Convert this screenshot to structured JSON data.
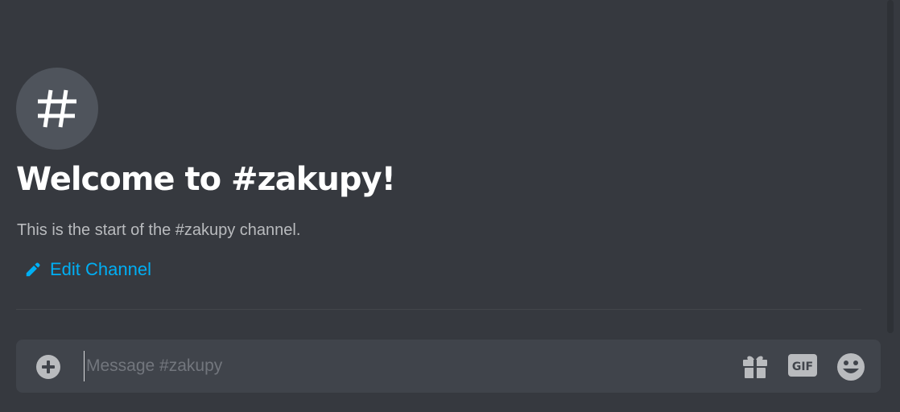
{
  "channel": {
    "icon": "hashtag-icon",
    "welcome_title": "Welcome to #zakupy!",
    "welcome_subtitle": "This is the start of the #zakupy channel.",
    "edit_label": "Edit Channel"
  },
  "composer": {
    "placeholder": "Message #zakupy",
    "attach_icon": "plus-circle-icon",
    "gift_icon": "gift-icon",
    "gif_label": "GIF",
    "emoji_icon": "smiley-emoji-icon"
  },
  "colors": {
    "background": "#36393f",
    "composer_background": "#40444b",
    "link": "#00aff4",
    "muted_text": "#b9bbbe",
    "icon_gray": "#b9bbbe"
  }
}
